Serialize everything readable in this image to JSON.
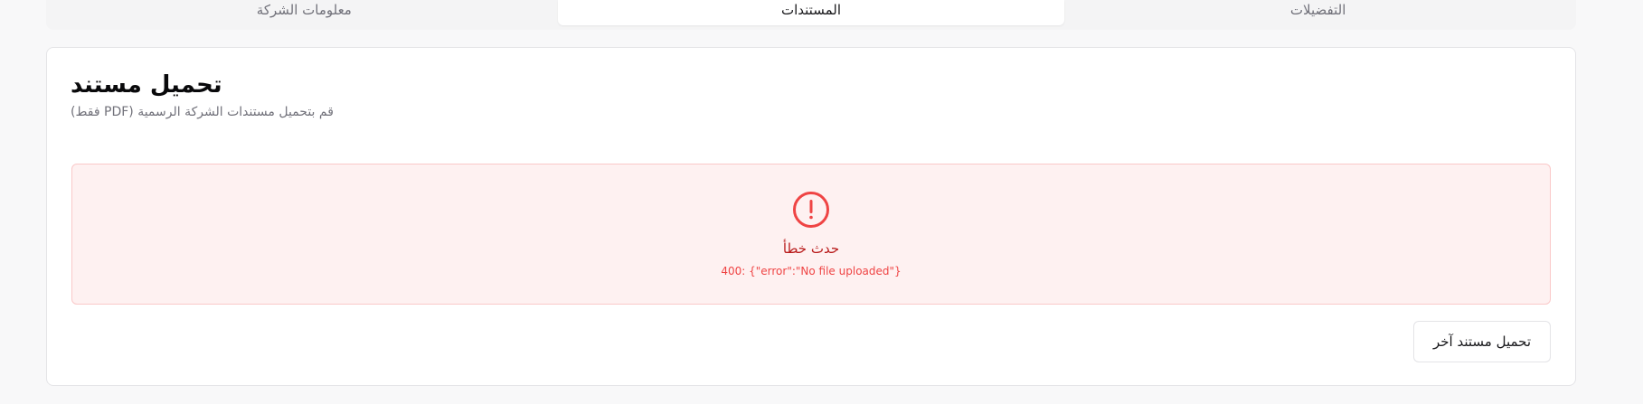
{
  "tabs": [
    {
      "label": "التفضيلات",
      "active": false
    },
    {
      "label": "المستندات",
      "active": true
    },
    {
      "label": "معلومات الشركة",
      "active": false
    }
  ],
  "card": {
    "title": "تحميل مستند",
    "description": "(فقط PDF) قم بتحميل مستندات الشركة الرسمية"
  },
  "error": {
    "icon": "alert-circle-icon",
    "title": "حدث خطأ",
    "detail": "400: {\"error\":\"No file uploaded\"}",
    "color": "#ef4444",
    "background": "#fef1f1"
  },
  "actions": {
    "upload_another_label": "تحميل مستند آخر"
  }
}
